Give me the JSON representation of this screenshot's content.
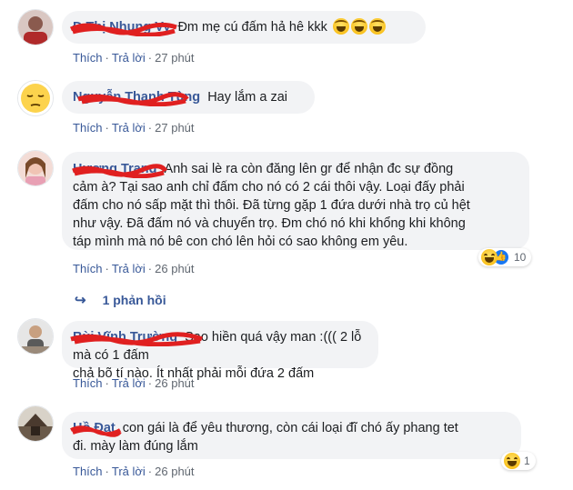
{
  "common": {
    "like": "Thích",
    "reply": "Trả lời",
    "separator": "·"
  },
  "comments": [
    {
      "author": "Đ Thị Nhung Vy",
      "text": "Đm mẹ cú đấm hả hê kkk",
      "emoji": [
        "laughing-tears",
        "laughing-tears",
        "laughing-tears"
      ],
      "time": "27 phút"
    },
    {
      "author": "Nguyễn Thanh Tùng",
      "text": "Hay lắm a zai",
      "time": "27 phút"
    },
    {
      "author": "Hương Trang",
      "text_lines": [
        "Anh sai lè ra còn đăng lên gr để nhận đc sự đồng",
        "cảm à? Tại sao anh chỉ đấm cho nó có 2 cái thôi vậy. Loại đấy phải",
        "đấm cho nó sấp mặt thì thôi. Đã từng gặp 1 đứa dưới nhà trọ củ hệt",
        "như vậy. Đã đấm nó và chuyển trọ. Đm chó nó khi khổng khi không",
        "táp mình mà nó bê con chó lên hỏi có sao không em yêu."
      ],
      "time": "26 phút",
      "reaction_count": "10",
      "replies_label": "1 phản hồi"
    },
    {
      "author": "Bùi Vĩnh Trường",
      "text_lines": [
        "Sao hiền quá vậy man :((( 2 lỗ mà có 1 đấm",
        "chả bõ tí nào. Ít nhất phải mỗi đứa 2 đấm"
      ],
      "time": "26 phút"
    },
    {
      "author": "Hồ Đạt",
      "text_lines": [
        "con gái là để yêu thương, còn cái loại đĩ chó ấy phang tet",
        "đi. mày làm đúng lắm"
      ],
      "time": "26 phút",
      "reaction_count": "1"
    }
  ],
  "colors": {
    "link": "#385898",
    "bubble": "#f2f3f5",
    "scribble": "#e02020"
  }
}
